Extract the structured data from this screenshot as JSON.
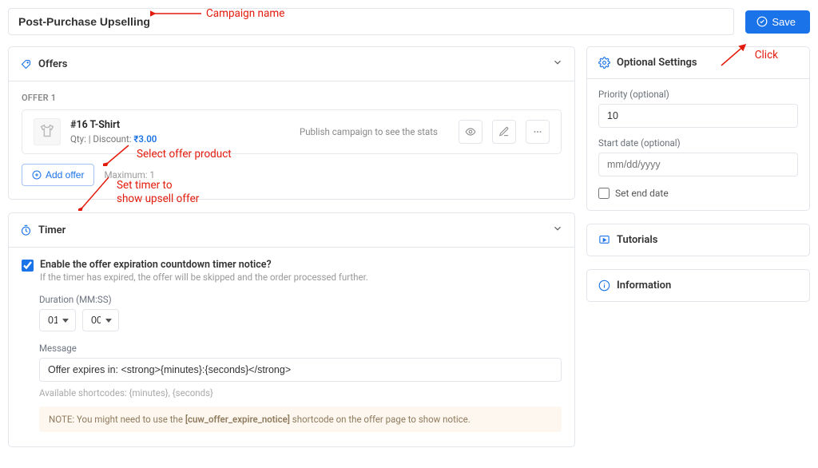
{
  "header": {
    "campaign_name": "Post-Purchase Upselling",
    "save_label": "Save"
  },
  "annotations": {
    "campaign_name": "Campaign name",
    "click": "Click",
    "select_offer": "Select offer product",
    "timer": "Set timer to\nshow upsell offer"
  },
  "offers_panel": {
    "title": "Offers",
    "offer_label": "OFFER 1",
    "product_title": "#16 T-Shirt",
    "qty_line_prefix": "Qty:   |   Discount: ",
    "discount_price": "₹3.00",
    "stats_text": "Publish campaign to see the stats",
    "add_offer_label": "Add offer",
    "maximum_text": "Maximum: 1"
  },
  "timer_panel": {
    "title": "Timer",
    "enable_label": "Enable the offer expiration countdown timer notice?",
    "enable_desc": "If the timer has expired, the offer will be skipped and the order processed further.",
    "duration_label": "Duration (MM:SS)",
    "duration_mm": "01",
    "duration_ss": "00",
    "message_label": "Message",
    "message_value": "Offer expires in: <strong>{minutes}:{seconds}</strong>",
    "shortcodes_text": "Available shortcodes: {minutes}, {seconds}",
    "note_prefix": "NOTE: You might need to use the ",
    "note_code": "[cuw_offer_expire_notice]",
    "note_suffix": " shortcode on the offer page to show notice."
  },
  "optional": {
    "title": "Optional Settings",
    "priority_label": "Priority (optional)",
    "priority_value": "10",
    "start_date_label": "Start date (optional)",
    "start_date_placeholder": "mm/dd/yyyy",
    "set_end_label": "Set end date"
  },
  "tutorials": {
    "title": "Tutorials"
  },
  "information": {
    "title": "Information"
  },
  "icons": {
    "offers": "offers-icon",
    "timer": "timer-icon",
    "settings": "settings-icon",
    "tutorials": "tutorials-icon",
    "info": "info-icon",
    "check": "check-circle-icon",
    "eye": "eye-icon",
    "edit": "edit-icon",
    "more": "more-icon",
    "plus": "plus-circle-icon",
    "chevron": "chevron-down-icon",
    "tshirt": "tshirt-icon"
  }
}
